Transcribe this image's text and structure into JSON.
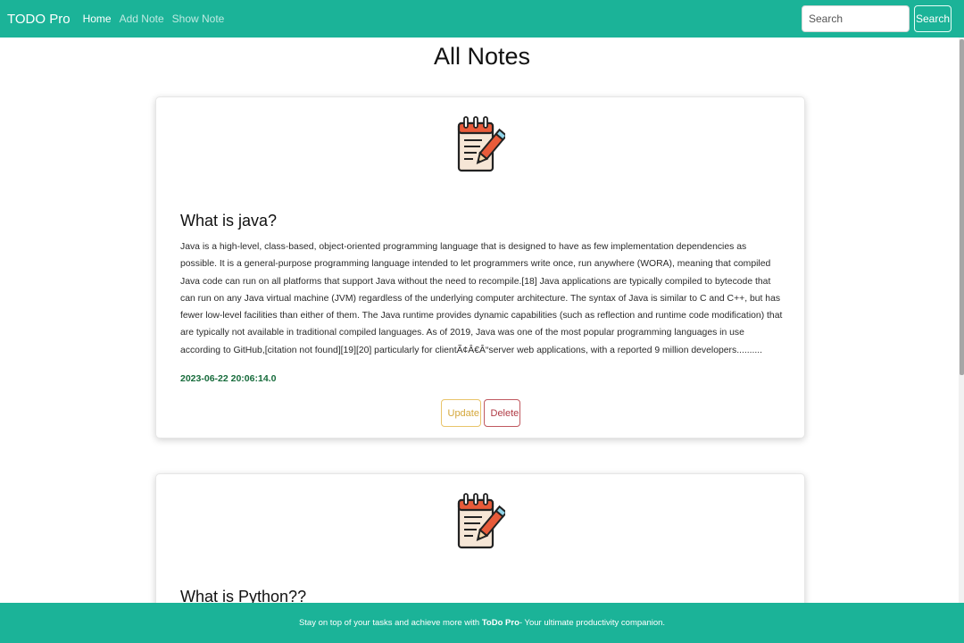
{
  "navbar": {
    "brand": "TODO Pro",
    "links": [
      "Home",
      "Add Note",
      "Show Note"
    ],
    "search_placeholder": "Search",
    "search_button": "Search"
  },
  "page_title": "All Notes",
  "notes": [
    {
      "icon": "notepad-pencil-icon",
      "title": "What is java?",
      "content": "Java is a high-level, class-based, object-oriented programming language that is designed to have as few implementation dependencies as possible. It is a general-purpose programming language intended to let programmers write once, run anywhere (WORA), meaning that compiled Java code can run on all platforms that support Java without the need to recompile.[18] Java applications are typically compiled to bytecode that can run on any Java virtual machine (JVM) regardless of the underlying computer architecture. The syntax of Java is similar to C and C++, but has fewer low-level facilities than either of them. The Java runtime provides dynamic capabilities (such as reflection and runtime code modification) that are typically not available in traditional compiled languages. As of 2019, Java was one of the most popular programming languages in use according to GitHub,[citation not found][19][20] particularly for clientÃ¢Â€Â“server web applications, with a reported 9 million developers..........",
      "date": "2023-06-22 20:06:14.0",
      "update_label": "Update",
      "delete_label": "Delete"
    },
    {
      "icon": "notepad-pencil-icon",
      "title": "What is Python??"
    }
  ],
  "footer": {
    "text_before": "Stay on top of your tasks and achieve more with ",
    "brand": "ToDo Pro",
    "text_after": " - Your ultimate productivity companion."
  },
  "colors": {
    "primary": "#1bb398",
    "update": "#e9c46a",
    "delete": "#c0585f",
    "date": "#166b3b"
  }
}
